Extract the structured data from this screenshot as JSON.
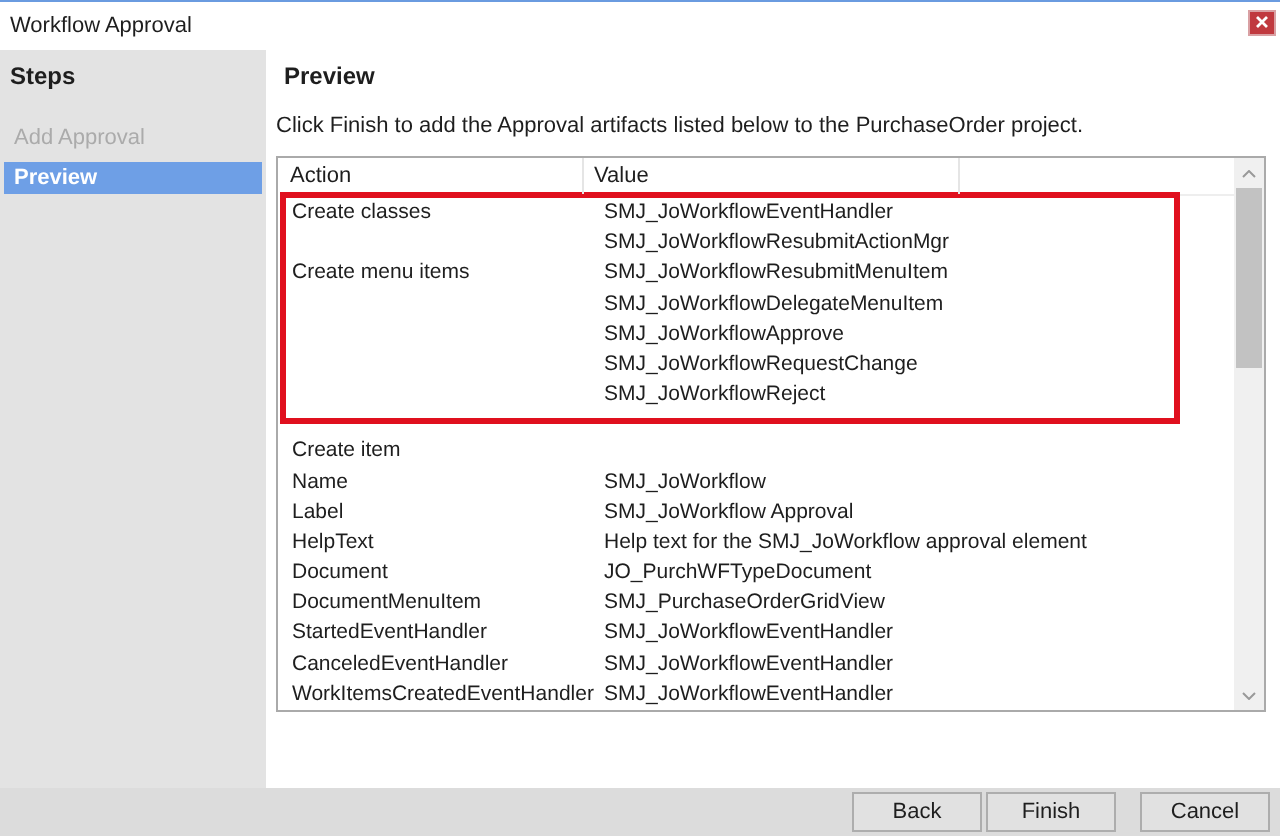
{
  "window": {
    "title": "Workflow Approval"
  },
  "sidebar": {
    "title": "Steps",
    "items": [
      {
        "label": "Add Approval",
        "disabled": true,
        "selected": false
      },
      {
        "label": "Preview",
        "disabled": false,
        "selected": true
      }
    ]
  },
  "page": {
    "title": "Preview",
    "description": "Click Finish to add the Approval artifacts listed below to the PurchaseOrder project."
  },
  "table": {
    "columns": [
      "Action",
      "Value"
    ],
    "groups": [
      {
        "highlighted": true,
        "rows": [
          {
            "action": "Create classes",
            "value": "SMJ_JoWorkflowEventHandler"
          },
          {
            "action": "",
            "value": "SMJ_JoWorkflowResubmitActionMgr"
          },
          {
            "action": "Create menu items",
            "value": "SMJ_JoWorkflowResubmitMenuItem"
          },
          {
            "action": "",
            "value": "SMJ_JoWorkflowDelegateMenuItem"
          },
          {
            "action": "",
            "value": "SMJ_JoWorkflowApprove"
          },
          {
            "action": "",
            "value": "SMJ_JoWorkflowRequestChange"
          },
          {
            "action": "",
            "value": "SMJ_JoWorkflowReject"
          }
        ]
      },
      {
        "highlighted": false,
        "rows": [
          {
            "action": "Create item",
            "value": ""
          },
          {
            "action": "Name",
            "value": "SMJ_JoWorkflow"
          },
          {
            "action": "Label",
            "value": "SMJ_JoWorkflow Approval"
          },
          {
            "action": "HelpText",
            "value": "Help text for the SMJ_JoWorkflow approval element"
          },
          {
            "action": "Document",
            "value": "JO_PurchWFTypeDocument"
          },
          {
            "action": "DocumentMenuItem",
            "value": "SMJ_PurchaseOrderGridView"
          },
          {
            "action": "StartedEventHandler",
            "value": "SMJ_JoWorkflowEventHandler"
          },
          {
            "action": "CanceledEventHandler",
            "value": "SMJ_JoWorkflowEventHandler"
          },
          {
            "action": "WorkItemsCreatedEventHandler",
            "value": "SMJ_JoWorkflowEventHandler"
          }
        ]
      }
    ]
  },
  "buttons": [
    {
      "label": "Back"
    },
    {
      "label": "Finish"
    },
    {
      "label": "Cancel"
    }
  ]
}
